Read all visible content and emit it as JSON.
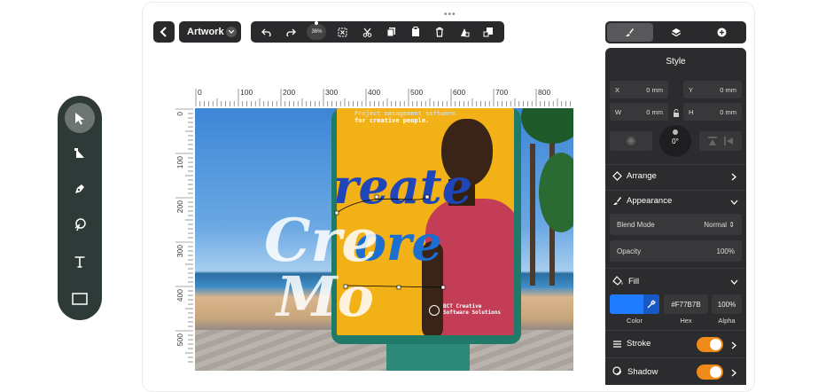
{
  "topbar": {
    "drag_handle": "•••",
    "artwork_label": "Artwork",
    "zoom_label": "36%"
  },
  "rulers": {
    "horizontal": [
      "0",
      "100",
      "200",
      "300",
      "400",
      "500",
      "600",
      "700",
      "800"
    ],
    "vertical": [
      "0",
      "100",
      "200",
      "300",
      "400",
      "500"
    ]
  },
  "canvas": {
    "poster_headline": "Project management software",
    "poster_sub": "for creative people.",
    "poster_word1": "reate",
    "poster_word2": "ore",
    "overlay_word1": "Cre",
    "overlay_word2": "Mo",
    "brand_line1": "BCT Creative",
    "brand_line2": "Software Solutions"
  },
  "panel": {
    "title": "Style",
    "x_label": "X",
    "x_value": "0 mm",
    "y_label": "Y",
    "y_value": "0 mm",
    "w_label": "W",
    "w_value": "0 mm",
    "h_label": "H",
    "h_value": "0 mm",
    "rotation": "0°",
    "arrange": "Arrange",
    "appearance": "Appearance",
    "blend_label": "Blend Mode",
    "blend_value": "Normal",
    "opacity_label": "Opacity",
    "opacity_value": "100%",
    "fill": "Fill",
    "fill_hex": "#F77B7B",
    "fill_alpha": "100%",
    "color_label": "Color",
    "hex_label": "Hex",
    "alpha_label": "Alpha",
    "stroke": "Stroke",
    "shadow": "Shadow",
    "accent": "#f08a1a",
    "swatch_color": "#1f7bff"
  }
}
